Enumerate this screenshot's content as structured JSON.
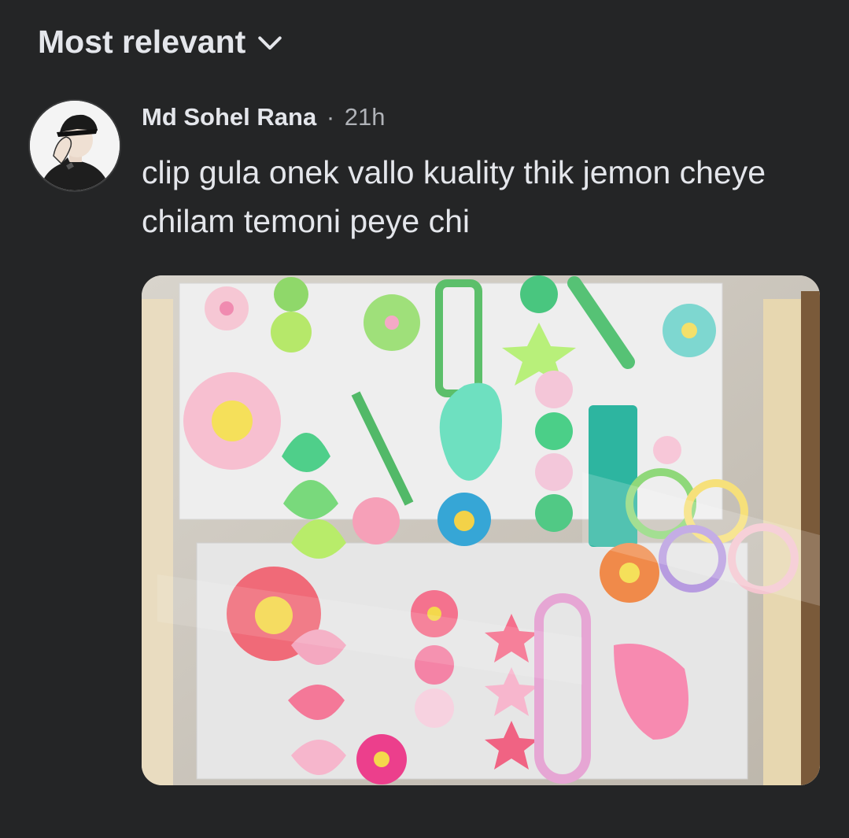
{
  "sort": {
    "label": "Most relevant",
    "icon": "chevron-down-icon"
  },
  "comment": {
    "author": "Md Sohel Rana",
    "separator": "·",
    "time": "21h",
    "text": "clip gula onek vallo kuality thik jemon cheye chilam temoni peye chi",
    "attachment": {
      "type": "photo"
    }
  },
  "colors": {
    "background": "#242526",
    "text": "#e4e6eb",
    "secondary": "#b0b3b8"
  }
}
